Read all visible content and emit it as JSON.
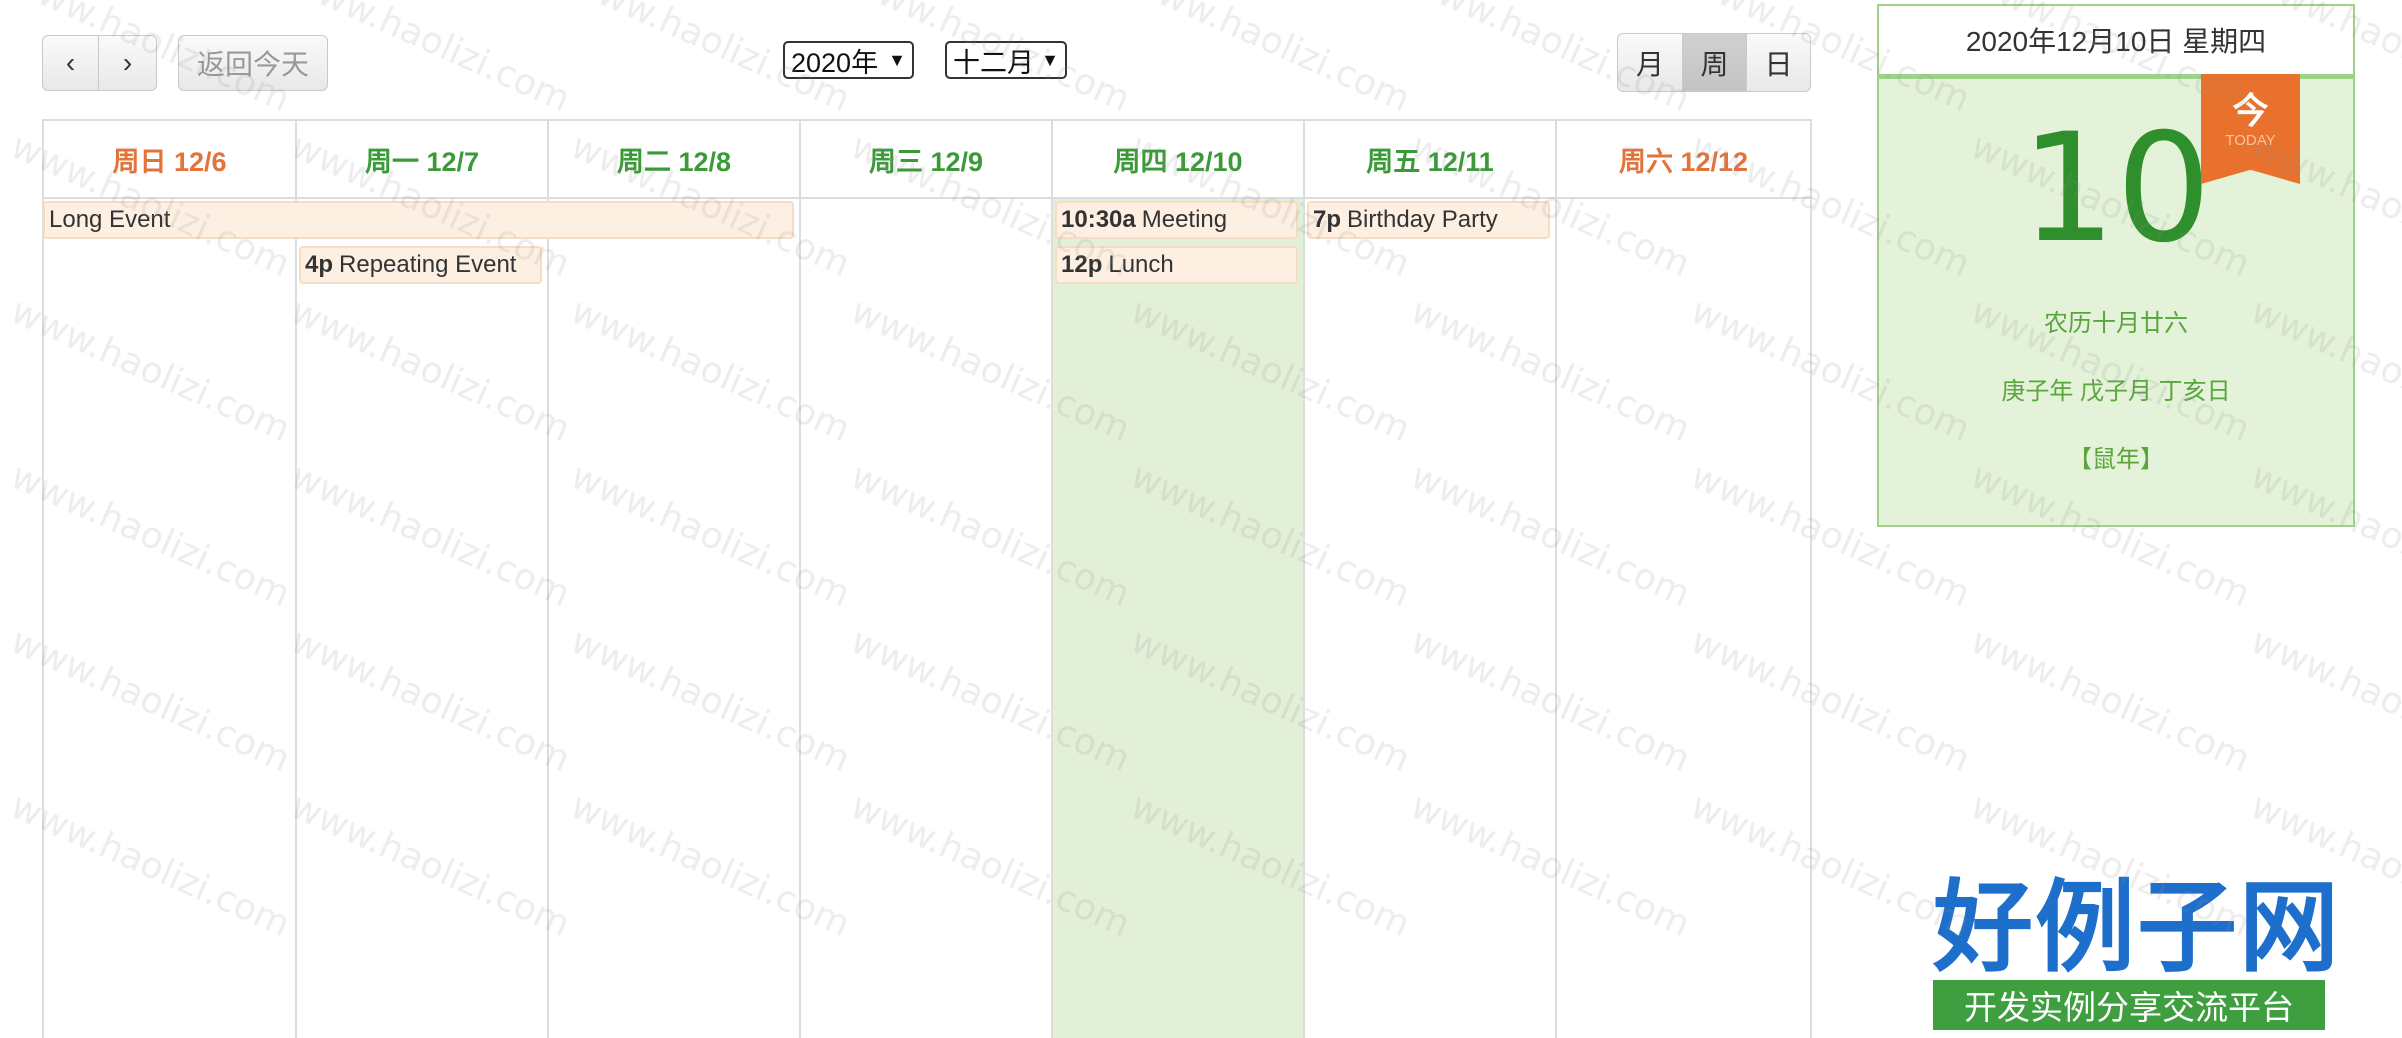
{
  "toolbar": {
    "prev_label": "‹",
    "next_label": "›",
    "today_label": "返回今天",
    "year_select": "2020年",
    "month_select": "十二月",
    "view_month": "月",
    "view_week": "周",
    "view_day": "日",
    "active_view": "周"
  },
  "week": {
    "days": [
      {
        "label": "周日 12/6",
        "weekend": true
      },
      {
        "label": "周一 12/7",
        "weekend": false
      },
      {
        "label": "周二 12/8",
        "weekend": false
      },
      {
        "label": "周三 12/9",
        "weekend": false
      },
      {
        "label": "周四 12/10",
        "weekend": false,
        "today": true
      },
      {
        "label": "周五 12/11",
        "weekend": false
      },
      {
        "label": "周六 12/12",
        "weekend": true
      }
    ],
    "events": [
      {
        "time": "",
        "title": "Long Event"
      },
      {
        "time": "4p",
        "title": "Repeating Event"
      },
      {
        "time": "10:30a",
        "title": "Meeting"
      },
      {
        "time": "12p",
        "title": "Lunch"
      },
      {
        "time": "7p",
        "title": "Birthday Party"
      }
    ]
  },
  "panel": {
    "header": "2020年12月10日 星期四",
    "day_number": "10",
    "ribbon_cn": "今",
    "ribbon_en": "TODAY",
    "lunar_date": "农历十月廿六",
    "ganzhi": "庚子年 戊子月 丁亥日",
    "zodiac": "【鼠年】"
  },
  "watermark": "www.haolizi.com",
  "logo": {
    "title": "好例子网",
    "subtitle": "开发实例分享交流平台"
  },
  "colors": {
    "weekday_header": "#3a9a38",
    "weekend_header": "#e2733a",
    "today_column": "#e3f0d8",
    "event_bg": "#fdf0e2",
    "ribbon": "#e8722d",
    "logo_blue": "#1e6fcc",
    "logo_green": "#3f9e40"
  }
}
